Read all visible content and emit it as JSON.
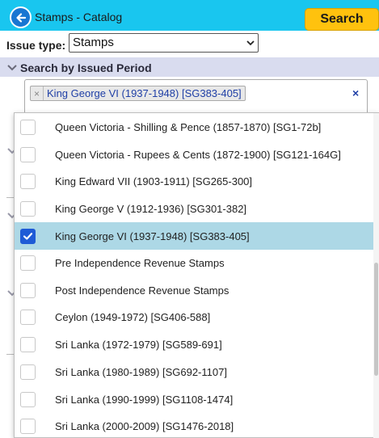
{
  "header": {
    "title": "Stamps - Catalog",
    "search_label": "Search"
  },
  "issue": {
    "label": "Issue type:",
    "selected": "Stamps"
  },
  "period_section": {
    "title": "Search by Issued Period",
    "selected_tag": "King George VI (1937-1948) [SG383-405]",
    "tag_remove": "×",
    "clear_all": "×"
  },
  "options": [
    {
      "label": "Queen Victoria - Shilling & Pence (1857-1870) [SG1-72b]",
      "checked": false
    },
    {
      "label": "Queen Victoria - Rupees & Cents (1872-1900) [SG121-164G]",
      "checked": false
    },
    {
      "label": "King Edward VII (1903-1911) [SG265-300]",
      "checked": false
    },
    {
      "label": "King George V (1912-1936) [SG301-382]",
      "checked": false
    },
    {
      "label": "King George VI (1937-1948) [SG383-405]",
      "checked": true
    },
    {
      "label": "Pre Independence Revenue Stamps",
      "checked": false
    },
    {
      "label": "Post Independence Revenue Stamps",
      "checked": false
    },
    {
      "label": "Ceylon (1949-1972) [SG406-588]",
      "checked": false
    },
    {
      "label": "Sri Lanka (1972-1979) [SG589-691]",
      "checked": false
    },
    {
      "label": "Sri Lanka (1980-1989) [SG692-1107]",
      "checked": false
    },
    {
      "label": "Sri Lanka (1990-1999) [SG1108-1474]",
      "checked": false
    },
    {
      "label": "Sri Lanka (2000-2009) [SG1476-2018]",
      "checked": false
    }
  ],
  "colors": {
    "topbar": "#19c6ef",
    "search_button": "#ffc20e",
    "section_bar": "#d9dcef",
    "selected_option": "#add8e6",
    "checkbox_checked": "#1e5bd6",
    "tag_text": "#1f3fa6"
  }
}
